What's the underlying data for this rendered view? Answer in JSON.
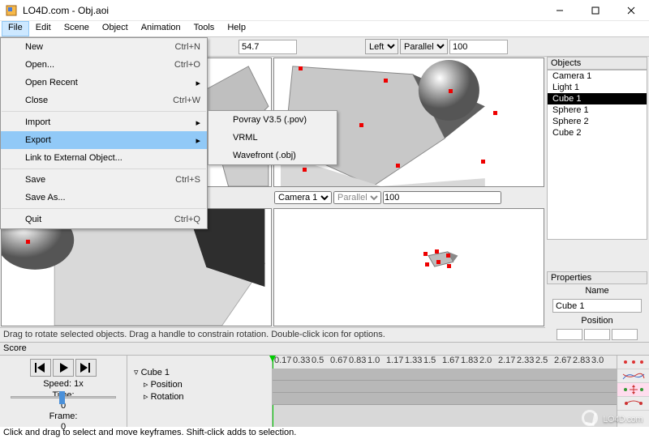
{
  "window": {
    "title": "LO4D.com - Obj.aoi"
  },
  "menubar": [
    "File",
    "Edit",
    "Scene",
    "Object",
    "Animation",
    "Tools",
    "Help"
  ],
  "file_menu": {
    "items": [
      {
        "label": "New",
        "shortcut": "Ctrl+N"
      },
      {
        "label": "Open...",
        "shortcut": "Ctrl+O"
      },
      {
        "label": "Open Recent",
        "sub": true
      },
      {
        "label": "Close",
        "shortcut": "Ctrl+W"
      },
      "sep",
      {
        "label": "Import",
        "sub": true
      },
      {
        "label": "Export",
        "sub": true,
        "hl": true
      },
      {
        "label": "Link to External Object..."
      },
      "sep",
      {
        "label": "Save",
        "shortcut": "Ctrl+S"
      },
      {
        "label": "Save As..."
      },
      "sep",
      {
        "label": "Quit",
        "shortcut": "Ctrl+Q"
      }
    ]
  },
  "export_sub": [
    "Povray V3.5 (.pov)",
    "VRML",
    "Wavefront (.obj)"
  ],
  "coord_row": {
    "visible_value": "54.7",
    "view": "Left",
    "proj": "Parallel",
    "zoom": "100"
  },
  "mid_row": {
    "view": "Camera 1",
    "proj": "Parallel",
    "zoom": "100"
  },
  "status1": "Drag to rotate selected objects.  Drag a handle to constrain rotation.  Double-click icon for options.",
  "objects_title": "Objects",
  "objects": [
    "Camera 1",
    "Light 1",
    "Cube 1",
    "Sphere 1",
    "Sphere 2",
    "Cube 2"
  ],
  "objects_selected_index": 2,
  "properties_title": "Properties",
  "props": {
    "name_label": "Name",
    "name_value": "Cube 1",
    "pos_label": "Position"
  },
  "score_title": "Score",
  "timeline": {
    "speed_label": "Speed: 1x",
    "time_label": "Time:",
    "time_value": "0",
    "frame_label": "Frame:",
    "frame_value": "0",
    "tree": [
      "Cube 1",
      "Position",
      "Rotation"
    ],
    "ticks": [
      "0.17",
      "0.33",
      "0.5",
      "0.67",
      "0.83",
      "1.0",
      "1.17",
      "1.33",
      "1.5",
      "1.67",
      "1.83",
      "2.0",
      "2.17",
      "2.33",
      "2.5",
      "2.67",
      "2.83",
      "3.0"
    ]
  },
  "status2": "Click and drag to select and move keyframes.  Shift-click adds to selection.",
  "watermark": "LO4D.com"
}
